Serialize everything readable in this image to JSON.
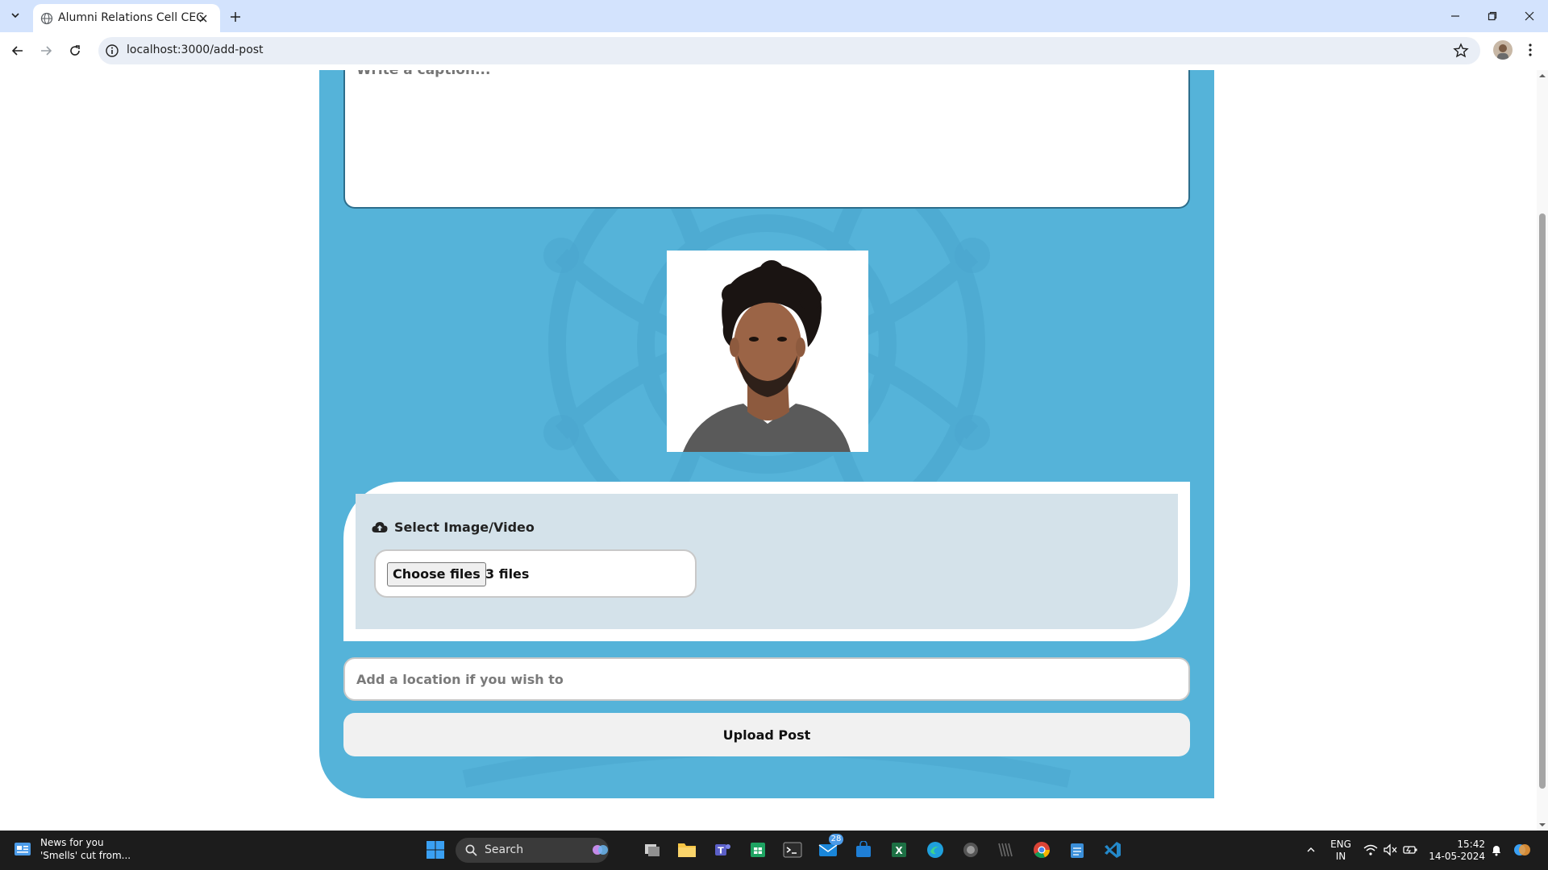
{
  "browser": {
    "tab_title": "Alumni Relations Cell CEC",
    "url": "localhost:3000/add-post"
  },
  "form": {
    "caption_placeholder": "Write a caption...",
    "upload_label": "Select Image/Video",
    "choose_files_label": "Choose files",
    "file_count": "3 files",
    "location_placeholder": "Add a location if you wish to",
    "submit_label": "Upload Post"
  },
  "colors": {
    "card_bg": "#55b3d9",
    "upload_inner_bg": "#d4e2ea",
    "chrome_bg": "#d3e3fd"
  },
  "taskbar": {
    "news_title": "News for you",
    "news_subtitle": "'Smells' cut from...",
    "search_label": "Search",
    "mail_badge": "28",
    "language_line1": "ENG",
    "language_line2": "IN",
    "time": "15:42",
    "date": "14-05-2024",
    "icons": [
      "start-icon",
      "search-icon",
      "copilot-icon",
      "task-view-icon",
      "file-explorer-icon",
      "teams-icon",
      "sheets-icon",
      "terminal-icon",
      "mail-icon",
      "store-icon",
      "excel-icon",
      "edge-icon",
      "app-icon",
      "app-icon-2",
      "chrome-icon",
      "notepad-icon",
      "vscode-icon"
    ]
  }
}
